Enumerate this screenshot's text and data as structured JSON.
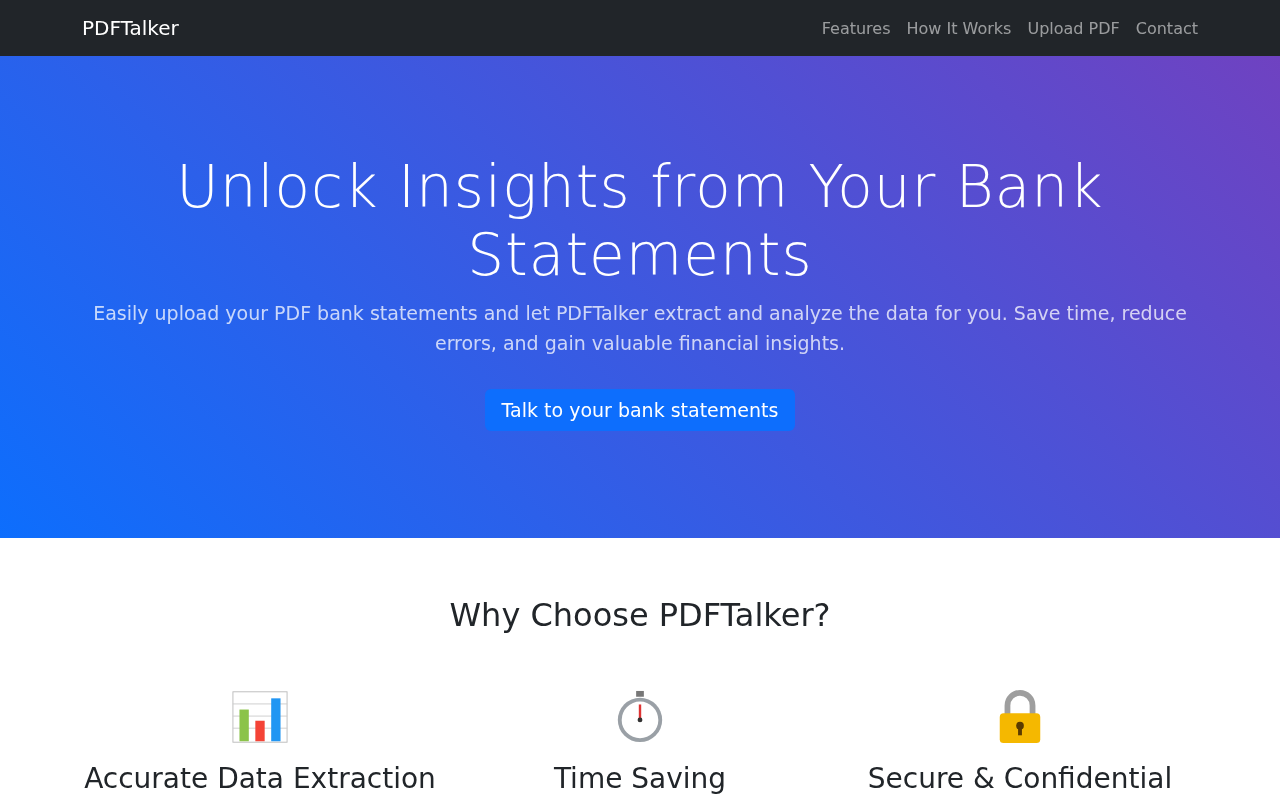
{
  "navbar": {
    "brand": "PDFTalker",
    "links": [
      "Features",
      "How It Works",
      "Upload PDF",
      "Contact"
    ]
  },
  "hero": {
    "title": "Unlock Insights from Your Bank Statements",
    "lead": "Easily upload your PDF bank statements and let PDFTalker extract and analyze the data for you. Save time, reduce errors, and gain valuable financial insights.",
    "button": "Talk to your bank statements"
  },
  "features": {
    "title": "Why Choose PDFTalker?",
    "items": [
      {
        "kind": "chart",
        "title": "Accurate Data Extraction"
      },
      {
        "kind": "stopwatch",
        "title": "Time Saving"
      },
      {
        "kind": "lock",
        "title": "Secure & Confidential"
      }
    ]
  }
}
